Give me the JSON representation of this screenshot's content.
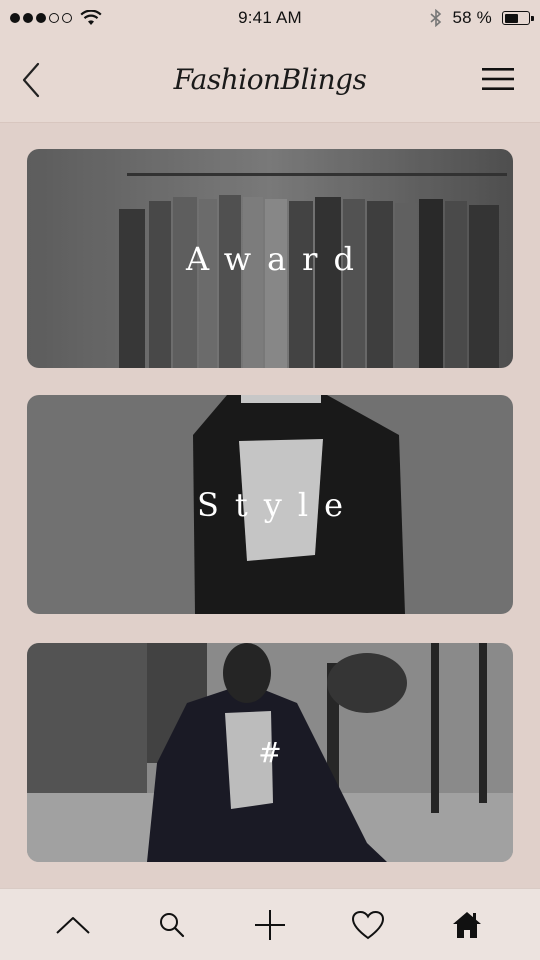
{
  "status_bar": {
    "time": "9:41 AM",
    "battery_percent_text": "58 %",
    "battery_level": 0.58,
    "signal_bars_filled": 3,
    "signal_bars_total": 5
  },
  "nav": {
    "logo_text": "FashionBlings"
  },
  "cards": [
    {
      "label": "Award"
    },
    {
      "label": "Style"
    },
    {
      "label": "#"
    }
  ],
  "tabs": [
    {
      "icon": "chevron-up-icon"
    },
    {
      "icon": "search-icon"
    },
    {
      "icon": "plus-icon"
    },
    {
      "icon": "heart-icon"
    },
    {
      "icon": "home-icon"
    }
  ],
  "colors": {
    "background": "#e6d8d2",
    "tab_bar": "#ece3df",
    "text": "#111111"
  }
}
